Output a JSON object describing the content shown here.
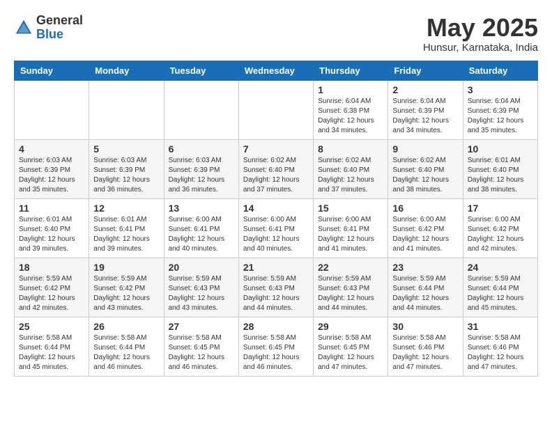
{
  "header": {
    "logo_general": "General",
    "logo_blue": "Blue",
    "month_title": "May 2025",
    "subtitle": "Hunsur, Karnataka, India"
  },
  "weekdays": [
    "Sunday",
    "Monday",
    "Tuesday",
    "Wednesday",
    "Thursday",
    "Friday",
    "Saturday"
  ],
  "weeks": [
    [
      {
        "day": "",
        "info": ""
      },
      {
        "day": "",
        "info": ""
      },
      {
        "day": "",
        "info": ""
      },
      {
        "day": "",
        "info": ""
      },
      {
        "day": "1",
        "info": "Sunrise: 6:04 AM\nSunset: 6:38 PM\nDaylight: 12 hours\nand 34 minutes."
      },
      {
        "day": "2",
        "info": "Sunrise: 6:04 AM\nSunset: 6:39 PM\nDaylight: 12 hours\nand 34 minutes."
      },
      {
        "day": "3",
        "info": "Sunrise: 6:04 AM\nSunset: 6:39 PM\nDaylight: 12 hours\nand 35 minutes."
      }
    ],
    [
      {
        "day": "4",
        "info": "Sunrise: 6:03 AM\nSunset: 6:39 PM\nDaylight: 12 hours\nand 35 minutes."
      },
      {
        "day": "5",
        "info": "Sunrise: 6:03 AM\nSunset: 6:39 PM\nDaylight: 12 hours\nand 36 minutes."
      },
      {
        "day": "6",
        "info": "Sunrise: 6:03 AM\nSunset: 6:39 PM\nDaylight: 12 hours\nand 36 minutes."
      },
      {
        "day": "7",
        "info": "Sunrise: 6:02 AM\nSunset: 6:40 PM\nDaylight: 12 hours\nand 37 minutes."
      },
      {
        "day": "8",
        "info": "Sunrise: 6:02 AM\nSunset: 6:40 PM\nDaylight: 12 hours\nand 37 minutes."
      },
      {
        "day": "9",
        "info": "Sunrise: 6:02 AM\nSunset: 6:40 PM\nDaylight: 12 hours\nand 38 minutes."
      },
      {
        "day": "10",
        "info": "Sunrise: 6:01 AM\nSunset: 6:40 PM\nDaylight: 12 hours\nand 38 minutes."
      }
    ],
    [
      {
        "day": "11",
        "info": "Sunrise: 6:01 AM\nSunset: 6:40 PM\nDaylight: 12 hours\nand 39 minutes."
      },
      {
        "day": "12",
        "info": "Sunrise: 6:01 AM\nSunset: 6:41 PM\nDaylight: 12 hours\nand 39 minutes."
      },
      {
        "day": "13",
        "info": "Sunrise: 6:00 AM\nSunset: 6:41 PM\nDaylight: 12 hours\nand 40 minutes."
      },
      {
        "day": "14",
        "info": "Sunrise: 6:00 AM\nSunset: 6:41 PM\nDaylight: 12 hours\nand 40 minutes."
      },
      {
        "day": "15",
        "info": "Sunrise: 6:00 AM\nSunset: 6:41 PM\nDaylight: 12 hours\nand 41 minutes."
      },
      {
        "day": "16",
        "info": "Sunrise: 6:00 AM\nSunset: 6:42 PM\nDaylight: 12 hours\nand 41 minutes."
      },
      {
        "day": "17",
        "info": "Sunrise: 6:00 AM\nSunset: 6:42 PM\nDaylight: 12 hours\nand 42 minutes."
      }
    ],
    [
      {
        "day": "18",
        "info": "Sunrise: 5:59 AM\nSunset: 6:42 PM\nDaylight: 12 hours\nand 42 minutes."
      },
      {
        "day": "19",
        "info": "Sunrise: 5:59 AM\nSunset: 6:42 PM\nDaylight: 12 hours\nand 43 minutes."
      },
      {
        "day": "20",
        "info": "Sunrise: 5:59 AM\nSunset: 6:43 PM\nDaylight: 12 hours\nand 43 minutes."
      },
      {
        "day": "21",
        "info": "Sunrise: 5:59 AM\nSunset: 6:43 PM\nDaylight: 12 hours\nand 44 minutes."
      },
      {
        "day": "22",
        "info": "Sunrise: 5:59 AM\nSunset: 6:43 PM\nDaylight: 12 hours\nand 44 minutes."
      },
      {
        "day": "23",
        "info": "Sunrise: 5:59 AM\nSunset: 6:44 PM\nDaylight: 12 hours\nand 44 minutes."
      },
      {
        "day": "24",
        "info": "Sunrise: 5:59 AM\nSunset: 6:44 PM\nDaylight: 12 hours\nand 45 minutes."
      }
    ],
    [
      {
        "day": "25",
        "info": "Sunrise: 5:58 AM\nSunset: 6:44 PM\nDaylight: 12 hours\nand 45 minutes."
      },
      {
        "day": "26",
        "info": "Sunrise: 5:58 AM\nSunset: 6:44 PM\nDaylight: 12 hours\nand 46 minutes."
      },
      {
        "day": "27",
        "info": "Sunrise: 5:58 AM\nSunset: 6:45 PM\nDaylight: 12 hours\nand 46 minutes."
      },
      {
        "day": "28",
        "info": "Sunrise: 5:58 AM\nSunset: 6:45 PM\nDaylight: 12 hours\nand 46 minutes."
      },
      {
        "day": "29",
        "info": "Sunrise: 5:58 AM\nSunset: 6:45 PM\nDaylight: 12 hours\nand 47 minutes."
      },
      {
        "day": "30",
        "info": "Sunrise: 5:58 AM\nSunset: 6:46 PM\nDaylight: 12 hours\nand 47 minutes."
      },
      {
        "day": "31",
        "info": "Sunrise: 5:58 AM\nSunset: 6:46 PM\nDaylight: 12 hours\nand 47 minutes."
      }
    ]
  ]
}
